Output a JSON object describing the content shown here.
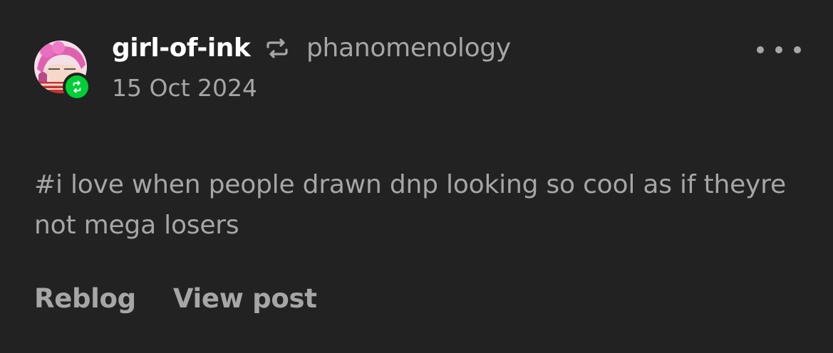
{
  "post": {
    "username": "girl-of-ink",
    "reblog_icon": "reblog-arrows-icon",
    "source_username": "phanomenology",
    "date": "15 Oct 2024",
    "more_icon": "more-options-icon",
    "tags": "#i love when people drawn dnp looking so cool as if theyre not mega losers",
    "actions": {
      "reblog_label": "Reblog",
      "view_post_label": "View post"
    }
  },
  "colors": {
    "background": "#222222",
    "primary_text": "#ffffff",
    "secondary_text": "#a6a6a6",
    "reblog_badge": "#00cf35"
  }
}
